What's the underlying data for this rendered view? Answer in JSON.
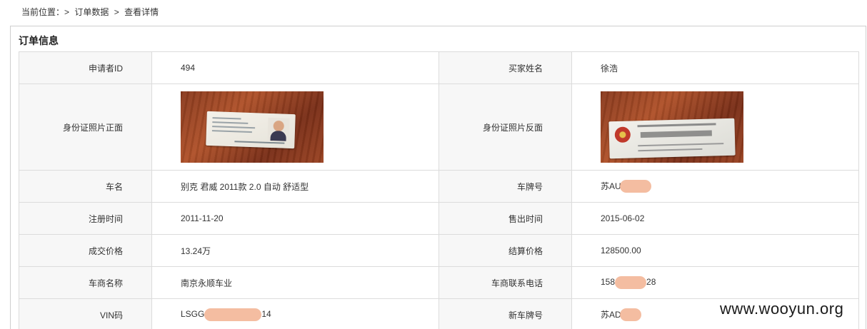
{
  "breadcrumb": {
    "prefix": "当前位置：>",
    "item1": "订单数据",
    "sep": ">",
    "item2": "查看详情"
  },
  "panel": {
    "title": "订单信息"
  },
  "rows": {
    "r0": {
      "l1": "申请者ID",
      "v1": "494",
      "l2": "买家姓名",
      "v2": "徐浩"
    },
    "r1": {
      "l1": "身份证照片正面",
      "l2": "身份证照片反面"
    },
    "r2": {
      "l1": "车名",
      "v1": "别克 君威 2011款 2.0 自动 舒适型",
      "l2": "车牌号",
      "v2": "苏AU"
    },
    "r3": {
      "l1": "注册时间",
      "v1": "2011-11-20",
      "l2": "售出时间",
      "v2": "2015-06-02"
    },
    "r4": {
      "l1": "成交价格",
      "v1": "13.24万",
      "l2": "结算价格",
      "v2": "128500.00"
    },
    "r5": {
      "l1": "车商名称",
      "v1": "南京永顺车业",
      "l2": "车商联系电话",
      "v2a": "158",
      "v2b": "28"
    },
    "r6": {
      "l1": "VIN码",
      "v1a": "LSGG",
      "v1b": "14",
      "l2": "新车牌号",
      "v2": "苏AD"
    }
  },
  "images": {
    "front": "id-card-front-photo",
    "back": "id-card-back-photo"
  },
  "colors": {
    "label_bg": "#f7f7f7",
    "border": "#dcdcdc",
    "redaction": "#f3b99c"
  },
  "watermark": "www.wooyun.org"
}
